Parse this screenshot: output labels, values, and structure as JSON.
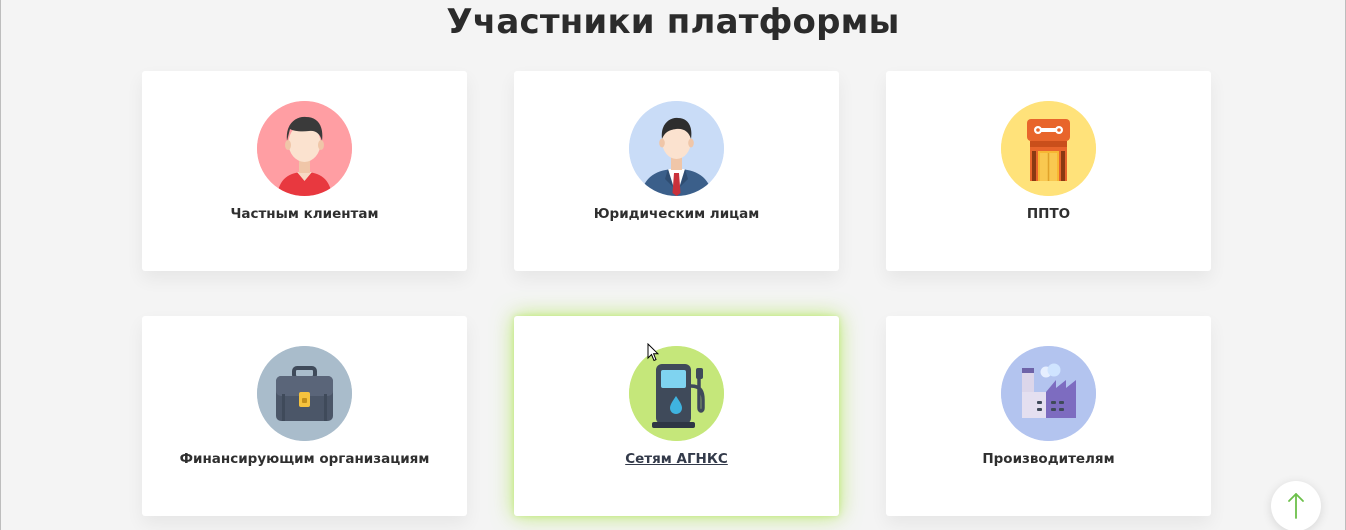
{
  "section": {
    "title": "Участники платформы"
  },
  "cards": [
    {
      "label": "Частным клиентам",
      "icon": "private-client-icon",
      "circle_color": "#ff9ea3"
    },
    {
      "label": "Юридическим лицам",
      "icon": "businessman-icon",
      "circle_color": "#c9dcf7"
    },
    {
      "label": "ППТО",
      "icon": "service-station-icon",
      "circle_color": "#ffe27a"
    },
    {
      "label": "Финансирующим организациям",
      "icon": "briefcase-icon",
      "circle_color": "#a9bccb"
    },
    {
      "label": "Сетям АГНКС",
      "icon": "gas-pump-icon",
      "circle_color": "#c5e77a"
    },
    {
      "label": "Производителям",
      "icon": "factory-icon",
      "circle_color": "#b3c4ef"
    }
  ],
  "scroll_top": {
    "icon": "arrow-up-icon",
    "color": "#6cc04a"
  }
}
